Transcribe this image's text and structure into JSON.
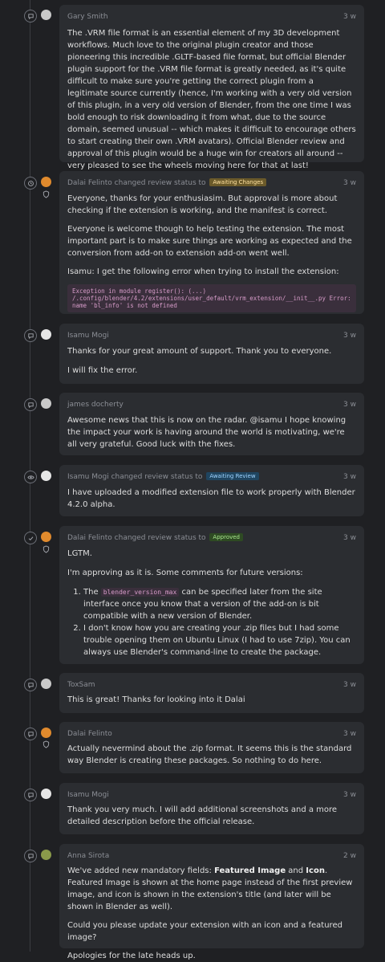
{
  "comments": [
    {
      "author": "Gary Smith",
      "time": "3 w",
      "paragraphs": [
        "The .VRM file format is an essential element of my 3D development workflows. Much love to the original plugin creator and those pioneering this incredible .GLTF-based file format, but official Blender plugin support for the .VRM file format is greatly needed, as it's quite difficult to make sure you're getting the correct plugin from a legitimate source currently (hence, I'm working with a very old version of this plugin, in a very old version of Blender, from the one time I was bold enough to risk downloading it from what, due to the source domain, seemed unusual -- which makes it difficult to encourage others to start creating their own .VRM avatars). Official Blender review and approval of this plugin would be a huge win for creators all around -- very pleased to see the wheels moving here for that at last!"
      ]
    },
    {
      "author": "Dalai Felinto",
      "action": "changed review status to",
      "status": "Awaiting Changes",
      "time": "3 w",
      "paragraphs": [
        "Everyone, thanks for your enthusiasim. But approval is more about checking if the extension is working, and the manifest is correct.",
        "Everyone is welcome though to help testing the extension. The most important part is to make sure things are working as expected and the conversion from add-on to extension add-on went well.",
        "Isamu: I get the following error when trying to install the extension:"
      ],
      "code": "Exception in module register(): (...)\n/.config/blender/4.2/extensions/user_default/vrm_extension/__init__.py Error: name 'bl_info' is not defined"
    },
    {
      "author": "Isamu Mogi",
      "time": "3 w",
      "paragraphs": [
        "Thanks for your great amount of support. Thank you to everyone.",
        "I will fix the error."
      ]
    },
    {
      "author": "james docherty",
      "time": "3 w",
      "paragraphs": [
        "Awesome news that this is now on the radar. @isamu I hope knowing the impact your work is having around the world is motivating, we're all very grateful. Good luck with the fixes."
      ]
    },
    {
      "author": "Isamu Mogi",
      "action": "changed review status to",
      "status": "Awaiting Review",
      "time": "3 w",
      "paragraphs": [
        "I have uploaded a modified extension file to work properly with Blender 4.2.0 alpha."
      ]
    },
    {
      "author": "Dalai Felinto",
      "action": "changed review status to",
      "status": "Approved",
      "time": "3 w",
      "paragraphs": [
        "LGTM.",
        "I'm approving as it is. Some comments for future versions:"
      ],
      "list": [
        {
          "pre": "The",
          "code": "blender_version_max",
          "post": "can be specified later from the site interface once you know that a version of the add-on is bit compatible with a new version of Blender."
        },
        {
          "text": "I don't know how you are creating your .zip files but I had some trouble opening them on Ubuntu Linux (I had to use 7zip). You can always use Blender's command-line to create the package."
        }
      ]
    },
    {
      "author": "ToxSam",
      "time": "3 w",
      "paragraphs": [
        "This is great! Thanks for looking into it Dalai"
      ]
    },
    {
      "author": "Dalai Felinto",
      "time": "3 w",
      "paragraphs": [
        "Actually nevermind about the .zip format. It seems this is the standard way Blender is creating these packages. So nothing to do here."
      ]
    },
    {
      "author": "Isamu Mogi",
      "time": "3 w",
      "paragraphs": [
        "Thank you very much. I will add additional screenshots and a more detailed description before the official release."
      ]
    },
    {
      "author": "Anna Sirota",
      "time": "2 w",
      "p1": {
        "a": "We've added new mandatory fields: ",
        "b1": "Featured Image",
        "c": " and ",
        "b2": "Icon",
        "d": ". Featured Image is shown at the home page instead of the first preview image, and icon is shown in the extension's title (and later will be shown in Blender as well)."
      },
      "paragraphs": [
        "",
        "Could you please update your extension with an icon and a featured image?",
        "Apologies for the late heads up."
      ]
    }
  ],
  "colors": {
    "awaiting_changes": "#6b5a2a",
    "awaiting_review": "#1f4560",
    "approved": "#2e4a23",
    "card": "#2b2d31",
    "background": "#1f2023"
  }
}
